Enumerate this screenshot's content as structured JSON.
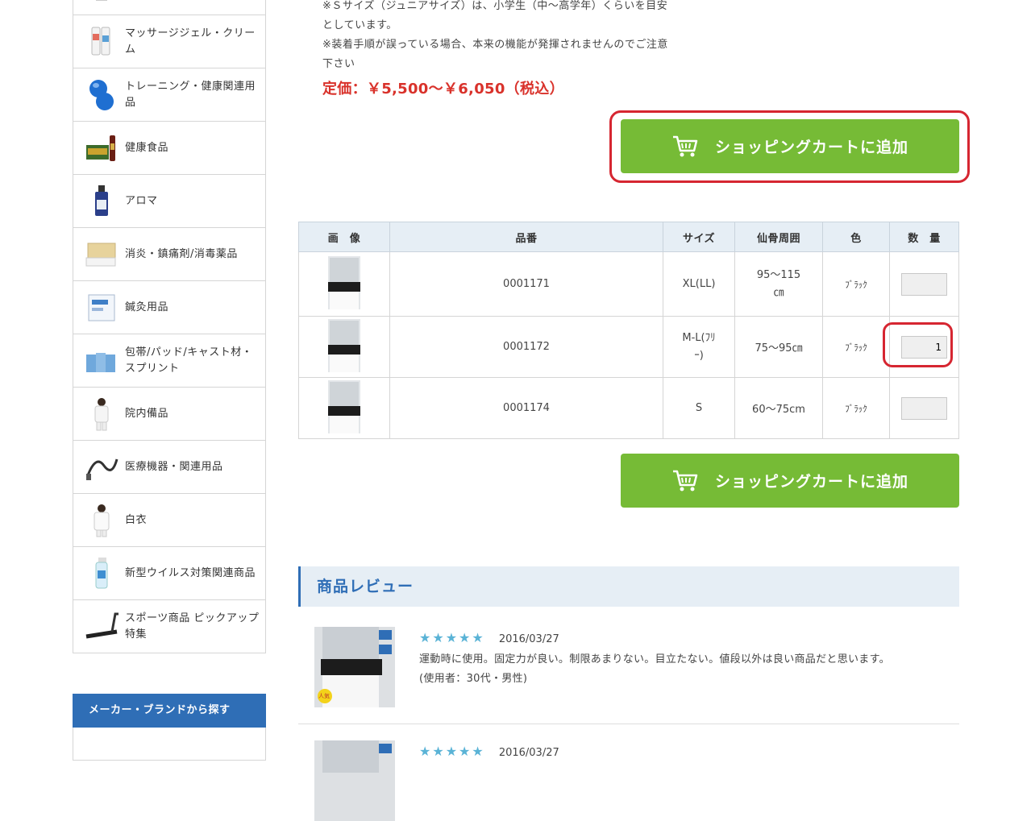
{
  "sidebar": {
    "categories": [
      {
        "label": "",
        "icon": "product-thumb-icon"
      },
      {
        "label": "マッサージジェル・クリーム",
        "icon": "gel-tubes-icon"
      },
      {
        "label": "トレーニング・健康関連用品",
        "icon": "peanut-ball-icon"
      },
      {
        "label": "健康食品",
        "icon": "health-food-icon"
      },
      {
        "label": "アロマ",
        "icon": "aroma-bottle-icon"
      },
      {
        "label": "消炎・鎮痛剤/消毒薬品",
        "icon": "medicine-box-icon"
      },
      {
        "label": "鍼灸用品",
        "icon": "acupuncture-box-icon"
      },
      {
        "label": "包帯/パッド/キャスト材・スプリント",
        "icon": "bandage-box-icon"
      },
      {
        "label": "院内備品",
        "icon": "uniform-person-icon"
      },
      {
        "label": "医療機器・関連用品",
        "icon": "cable-icon"
      },
      {
        "label": "白衣",
        "icon": "white-coat-icon"
      },
      {
        "label": "新型ウイルス対策関連商品",
        "icon": "spray-bottle-icon"
      },
      {
        "label": "スポーツ商品 ピックアップ特集",
        "icon": "treadmill-icon"
      }
    ],
    "brand_heading": "メーカー・ブランドから探す"
  },
  "product": {
    "note1": "※Ｓサイズ（ジュニアサイズ）は、小学生（中～高学年）くらいを目安としています。",
    "note2": "※装着手順が誤っている場合、本来の機能が発揮されませんのでご注意下さい",
    "price": "定価：￥5,500〜￥6,050（税込）",
    "cart_button_label": "ショッピングカートに追加"
  },
  "variants": {
    "headers": [
      "画　像",
      "品番",
      "サイズ",
      "仙骨周囲",
      "色",
      "数　量"
    ],
    "rows": [
      {
        "code": "0001171",
        "size": "XL(LL)",
        "girth": "95〜115㎝",
        "color": "ﾌﾞﾗｯｸ",
        "qty": ""
      },
      {
        "code": "0001172",
        "size": "M-L(ﾌﾘｰ)",
        "girth": "75〜95㎝",
        "color": "ﾌﾞﾗｯｸ",
        "qty": "1"
      },
      {
        "code": "0001174",
        "size": "S",
        "girth": "60〜75cm",
        "color": "ﾌﾞﾗｯｸ",
        "qty": ""
      }
    ]
  },
  "reviews": {
    "heading": "商品レビュー",
    "items": [
      {
        "stars": "★★★★★",
        "rating": 5,
        "date": "2016/03/27",
        "text": "運動時に使用。固定力が良い。制限あまりない。目立たない。値段以外は良い商品だと思います。",
        "user": "(使用者：30代・男性)",
        "badge": "人気"
      },
      {
        "stars": "★★★★★",
        "rating": 5,
        "date": "2016/03/27",
        "text": "",
        "user": "",
        "badge": ""
      }
    ]
  },
  "colors": {
    "accent_blue": "#2f6eb6",
    "cart_green": "#76bb36",
    "price_red": "#d9322b",
    "highlight_red": "#d62631",
    "star_blue": "#5ab3d6"
  }
}
